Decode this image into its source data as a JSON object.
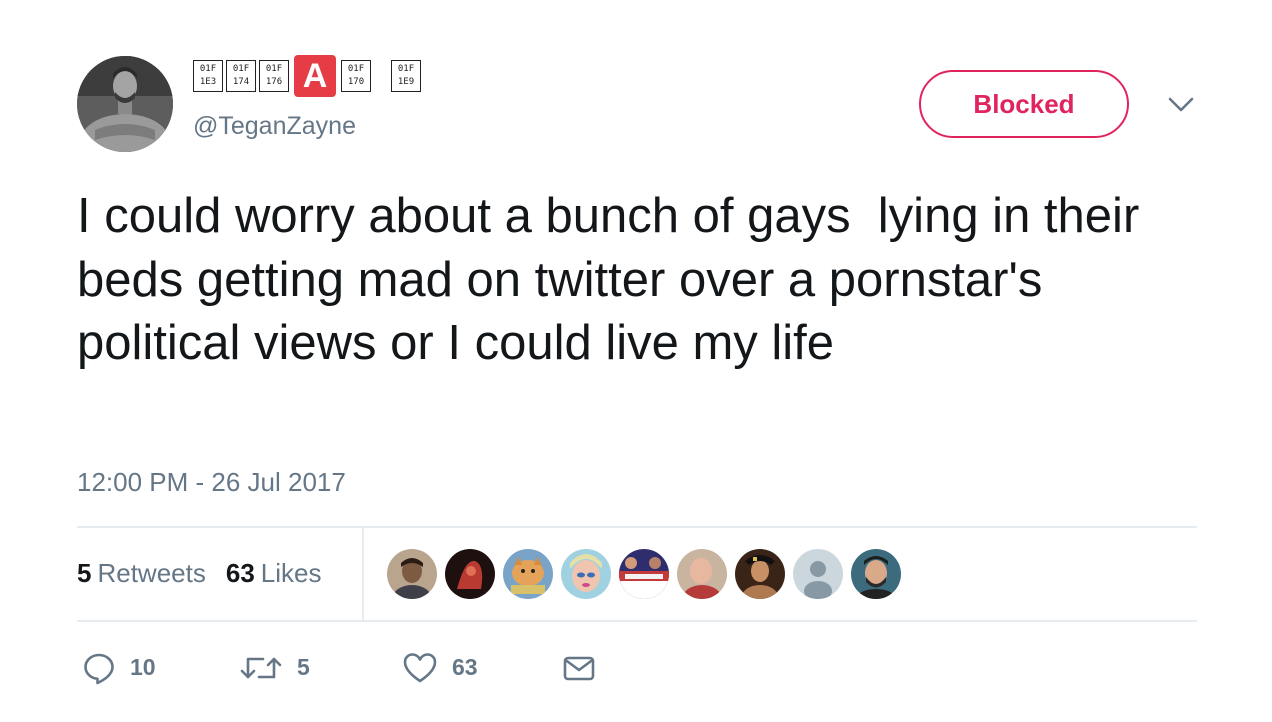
{
  "user": {
    "display_name_glyphs": [
      [
        "01F",
        "1E3"
      ],
      [
        "01F",
        "174"
      ],
      [
        "01F",
        "176"
      ],
      "A",
      [
        "01F",
        "170"
      ],
      [
        "01F",
        "1E9"
      ]
    ],
    "handle": "@TeganZayne"
  },
  "header": {
    "blocked_label": "Blocked",
    "menu_icon": "chevron-down-icon"
  },
  "tweet": {
    "text": "I could worry about a bunch of gays  lying in their beds getting mad on twitter over a pornstar's political views or I could live my life",
    "timestamp": "12:00 PM - 26 Jul 2017"
  },
  "stats": {
    "retweets_count": "5",
    "retweets_label": "Retweets",
    "likes_count": "63",
    "likes_label": "Likes"
  },
  "actions": {
    "reply_count": "10",
    "retweet_count": "5",
    "like_count": "63",
    "icons": [
      "reply-icon",
      "retweet-icon",
      "like-icon",
      "message-icon"
    ]
  },
  "colors": {
    "blocked_accent": "#e0245e",
    "secondary_text": "#657786",
    "emoji_red": "#e53c45",
    "divider": "#e6ecf0"
  }
}
